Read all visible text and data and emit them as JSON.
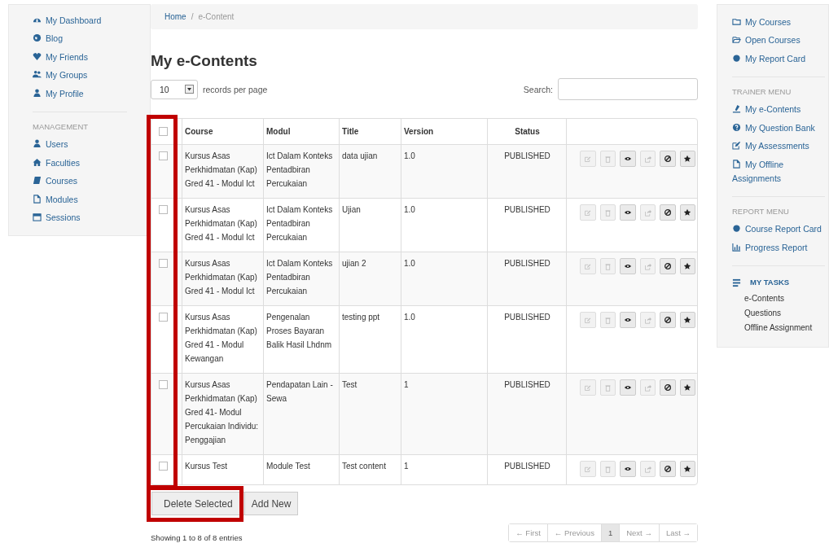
{
  "left_sidebar": {
    "sections": [
      {
        "items": [
          {
            "label": "My Dashboard"
          },
          {
            "label": "Blog"
          },
          {
            "label": "My Friends"
          },
          {
            "label": "My Groups"
          },
          {
            "label": "My Profile"
          }
        ]
      },
      {
        "heading": "MANAGEMENT",
        "items": [
          {
            "label": "Users"
          },
          {
            "label": "Faculties"
          },
          {
            "label": "Courses"
          },
          {
            "label": "Modules"
          },
          {
            "label": "Sessions"
          }
        ]
      }
    ]
  },
  "breadcrumb": {
    "separator": "/",
    "items": [
      {
        "label": "Home",
        "link": true
      },
      {
        "label": "e-Content",
        "link": false
      }
    ]
  },
  "page_title": "My e-Contents",
  "length_menu": {
    "value": "10",
    "label": "records per page"
  },
  "search": {
    "label": "Search:"
  },
  "table": {
    "select_all": {
      "checked": false
    },
    "columns": [
      "Course",
      "Modul",
      "Title",
      "Version",
      "Status"
    ],
    "row_actions": [
      {
        "kind": "edit",
        "disabled": true
      },
      {
        "kind": "trash",
        "disabled": true
      },
      {
        "kind": "eye",
        "disabled": false
      },
      {
        "kind": "share",
        "disabled": true
      },
      {
        "kind": "ban",
        "disabled": false
      },
      {
        "kind": "star",
        "disabled": false
      }
    ],
    "rows": [
      {
        "checked": false,
        "course": "Kursus Asas Perkhidmatan (Kap) Gred 41 - Modul Ict",
        "modul": "Ict Dalam Konteks Pentadbiran Percukaian",
        "title": "data ujian",
        "version": "1.0",
        "status": "PUBLISHED"
      },
      {
        "checked": false,
        "course": "Kursus Asas Perkhidmatan (Kap) Gred 41 - Modul Ict",
        "modul": "Ict Dalam Konteks Pentadbiran Percukaian",
        "title": "Ujian",
        "version": "1.0",
        "status": "PUBLISHED"
      },
      {
        "checked": false,
        "course": "Kursus Asas Perkhidmatan (Kap) Gred 41 - Modul Ict",
        "modul": "Ict Dalam Konteks Pentadbiran Percukaian",
        "title": "ujian 2",
        "version": "1.0",
        "status": "PUBLISHED"
      },
      {
        "checked": false,
        "course": "Kursus Asas Perkhidmatan (Kap) Gred 41 - Modul Kewangan",
        "modul": "Pengenalan Proses Bayaran Balik Hasil Lhdnm",
        "title": "testing ppt",
        "version": "1.0",
        "status": "PUBLISHED"
      },
      {
        "checked": false,
        "course": "Kursus Asas Perkhidmatan (Kap) Gred 41- Modul Percukaian Individu: Penggajian",
        "modul": "Pendapatan Lain - Sewa",
        "title": "Test",
        "version": "1",
        "status": "PUBLISHED"
      },
      {
        "checked": false,
        "course": "Kursus Test",
        "modul": "Module Test",
        "title": "Test content",
        "version": "1",
        "status": "PUBLISHED"
      }
    ]
  },
  "buttons": [
    "Delete Selected",
    "Add New"
  ],
  "info": "Showing 1 to 8 of 8 entries",
  "pagination": [
    {
      "label": "← First",
      "selected": false,
      "disabled": true
    },
    {
      "label": "← Previous",
      "selected": false,
      "disabled": true
    },
    {
      "label": "1",
      "selected": true,
      "disabled": false
    },
    {
      "label": "Next →",
      "selected": false,
      "disabled": true
    },
    {
      "label": "Last →",
      "selected": false,
      "disabled": true
    }
  ],
  "right_sidebar": {
    "sections": [
      {
        "items": [
          {
            "label": "My Courses"
          },
          {
            "label": "Open Courses"
          },
          {
            "label": "My Report Card"
          }
        ]
      },
      {
        "heading": "TRAINER MENU",
        "items": [
          {
            "label": "My e-Contents"
          },
          {
            "label": "My Question Bank"
          },
          {
            "label": "My Assessments"
          },
          {
            "label": "My Offline Assignments"
          }
        ]
      },
      {
        "heading": "REPORT MENU",
        "items": [
          {
            "label": "Course Report Card"
          },
          {
            "label": "Progress Report"
          }
        ]
      }
    ],
    "tasks": {
      "heading": "MY TASKS",
      "items": [
        "e-Contents",
        "Questions",
        "Offline Assignment"
      ]
    }
  }
}
